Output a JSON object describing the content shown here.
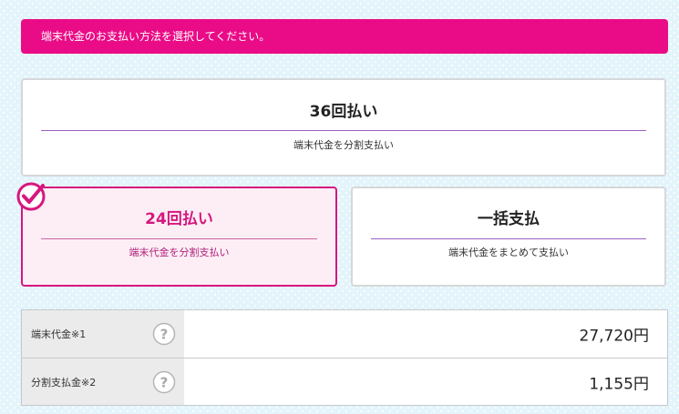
{
  "banner": {
    "text": "端末代金のお支払い方法を選択してください。"
  },
  "options": [
    {
      "title": "36回払い",
      "subtitle": "端末代金を分割支払い",
      "selected": false
    },
    {
      "title": "24回払い",
      "subtitle": "端末代金を分割支払い",
      "selected": true
    },
    {
      "title": "一括支払",
      "subtitle": "端末代金をまとめて支払い",
      "selected": false
    }
  ],
  "price_table": {
    "rows": [
      {
        "label": "端末代金※1",
        "value": "27,720円"
      },
      {
        "label": "分割支払金※2",
        "value": "1,155円"
      }
    ]
  },
  "colors": {
    "accent": "#ea0b86",
    "selected_border": "#d6177f",
    "selected_bg": "#fdeef5",
    "divider": "#9c5fc4"
  },
  "icons": {
    "selected_marker": "check-circle-icon",
    "help": "question-circle-icon"
  }
}
